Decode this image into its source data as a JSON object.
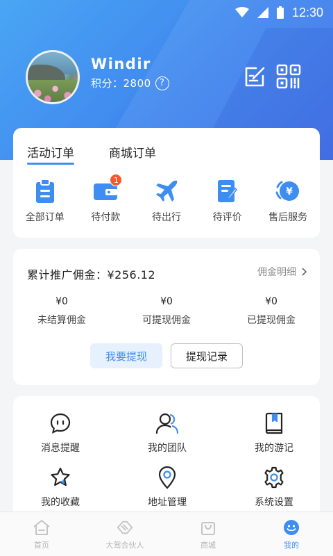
{
  "status_bar": {
    "time": "12:30"
  },
  "profile": {
    "username": "Windir",
    "points_label": "积分：",
    "points_value": "2800",
    "help_symbol": "?"
  },
  "orders": {
    "tabs": [
      {
        "label": "活动订单",
        "active": true
      },
      {
        "label": "商城订单",
        "active": false
      }
    ],
    "items": [
      {
        "label": "全部订单",
        "icon": "clipboard-icon"
      },
      {
        "label": "待付款",
        "icon": "wallet-icon",
        "badge": "1"
      },
      {
        "label": "待出行",
        "icon": "airplane-icon"
      },
      {
        "label": "待评价",
        "icon": "review-icon"
      },
      {
        "label": "售后服务",
        "icon": "yen-refund-icon"
      }
    ]
  },
  "commission": {
    "title": "累计推广佣金：¥256.12",
    "detail_label": "佣金明细",
    "stats": [
      {
        "value": "¥0",
        "label": "未结算佣金"
      },
      {
        "value": "¥0",
        "label": "可提现佣金"
      },
      {
        "value": "¥0",
        "label": "已提现佣金"
      }
    ],
    "withdraw_button": "我要提现",
    "records_button": "提现记录"
  },
  "menu": {
    "items": [
      {
        "label": "消息提醒",
        "icon": "message-icon"
      },
      {
        "label": "我的团队",
        "icon": "team-icon"
      },
      {
        "label": "我的游记",
        "icon": "book-icon"
      },
      {
        "label": "我的收藏",
        "icon": "star-icon"
      },
      {
        "label": "地址管理",
        "icon": "location-icon"
      },
      {
        "label": "系统设置",
        "icon": "settings-icon"
      }
    ]
  },
  "bottom_nav": [
    {
      "label": "首页",
      "icon": "home-icon",
      "active": false
    },
    {
      "label": "大驾合伙人",
      "icon": "handshake-icon",
      "active": false
    },
    {
      "label": "商城",
      "icon": "shopping-bag-icon",
      "active": false
    },
    {
      "label": "我的",
      "icon": "profile-icon",
      "active": true
    }
  ],
  "colors": {
    "accent": "#3d8ef0",
    "badge": "#f25a2e",
    "header_gradient_start": "#4aa6f4",
    "header_gradient_end": "#3a6be8"
  }
}
